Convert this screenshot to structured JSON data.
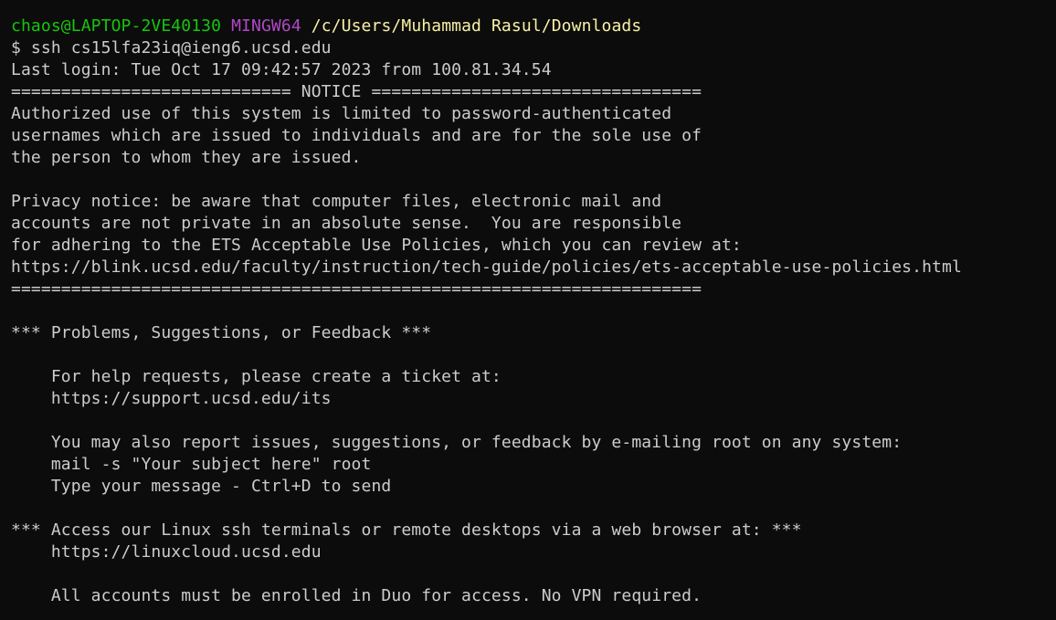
{
  "terminal": {
    "prompt": {
      "user": "chaos@LAPTOP-2VE40130",
      "env": "MINGW64",
      "path": "/c/Users/Muhammad Rasul/Downloads"
    },
    "command": "$ ssh cs15lfa23iq@ieng6.ucsd.edu",
    "lines": [
      "Last login: Tue Oct 17 09:42:57 2023 from 100.81.34.54",
      "============================ NOTICE =================================",
      "Authorized use of this system is limited to password-authenticated",
      "usernames which are issued to individuals and are for the sole use of",
      "the person to whom they are issued.",
      "",
      "Privacy notice: be aware that computer files, electronic mail and",
      "accounts are not private in an absolute sense.  You are responsible",
      "for adhering to the ETS Acceptable Use Policies, which you can review at:",
      "https://blink.ucsd.edu/faculty/instruction/tech-guide/policies/ets-acceptable-use-policies.html",
      "=====================================================================",
      "",
      "*** Problems, Suggestions, or Feedback ***",
      "",
      "    For help requests, please create a ticket at:",
      "    https://support.ucsd.edu/its",
      "",
      "    You may also report issues, suggestions, or feedback by e-mailing root on any system:",
      "    mail -s \"Your subject here\" root",
      "    Type your message - Ctrl+D to send",
      "",
      "*** Access our Linux ssh terminals or remote desktops via a web browser at: ***",
      "    https://linuxcloud.ucsd.edu",
      "",
      "    All accounts must be enrolled in Duo for access. No VPN required."
    ]
  },
  "colors": {
    "background": "#0c0c0c",
    "text": "#cccccc",
    "user": "#16c60c",
    "env": "#b148c6",
    "path": "#f9f1a5"
  }
}
